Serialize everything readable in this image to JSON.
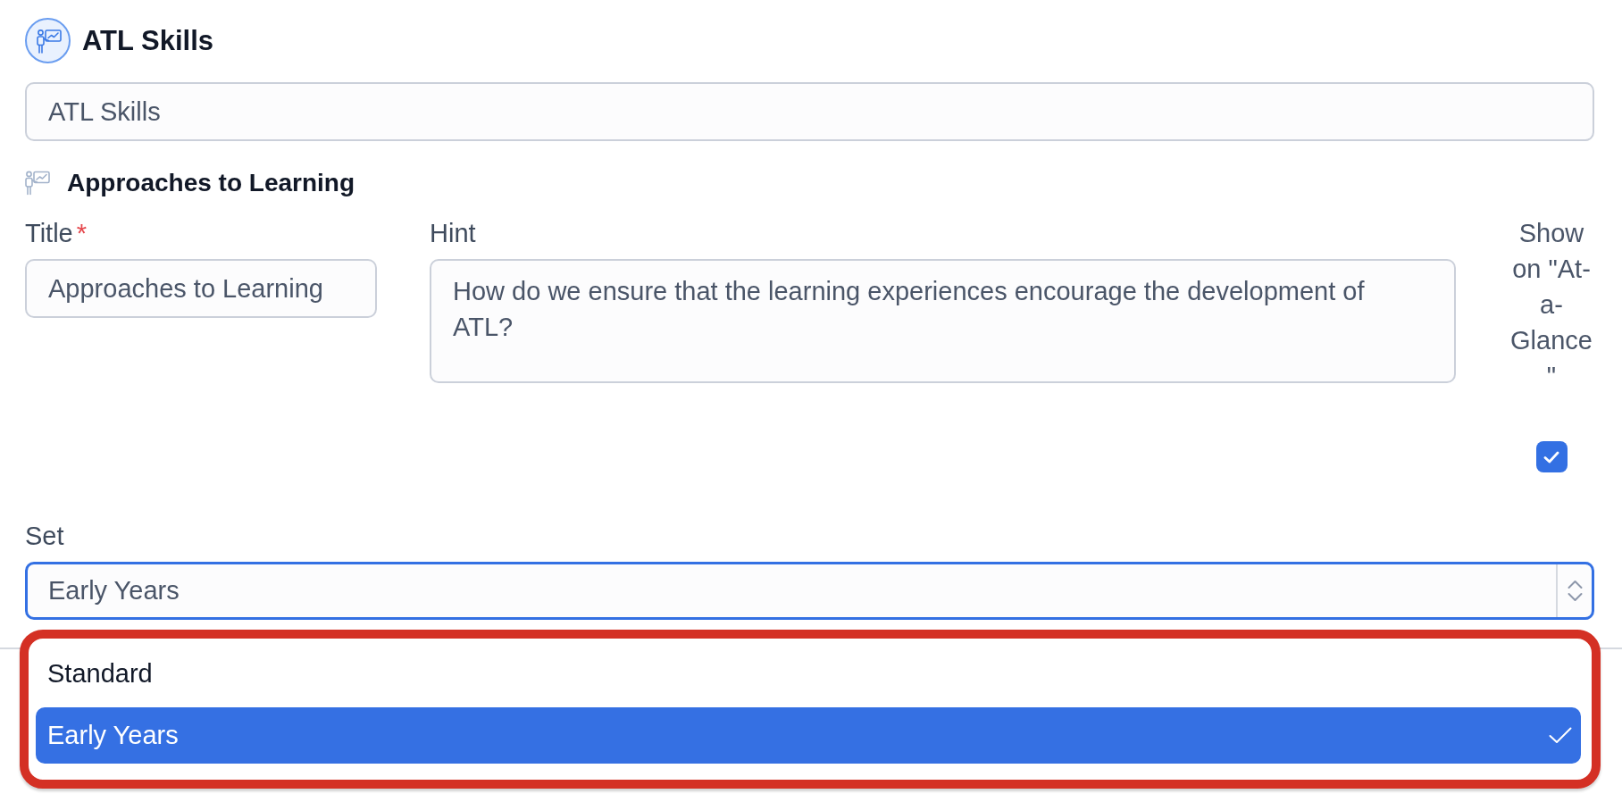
{
  "header": {
    "title": "ATL Skills"
  },
  "name_field": {
    "value": "ATL Skills"
  },
  "section": {
    "title": "Approaches to Learning"
  },
  "fields": {
    "title": {
      "label": "Title",
      "required_mark": "*",
      "value": "Approaches to Learning"
    },
    "hint": {
      "label": "Hint",
      "value": "How do we ensure that the learning experiences encourage the development of ATL?"
    },
    "show_at_a_glance": {
      "label": "Show on \"At-a-Glance\"",
      "checked": true
    }
  },
  "set": {
    "label": "Set",
    "value": "Early Years",
    "focused": true,
    "dropdown": {
      "highlighted": true,
      "options": [
        {
          "label": "Standard",
          "selected": false
        },
        {
          "label": "Early Years",
          "selected": true
        }
      ]
    }
  }
}
